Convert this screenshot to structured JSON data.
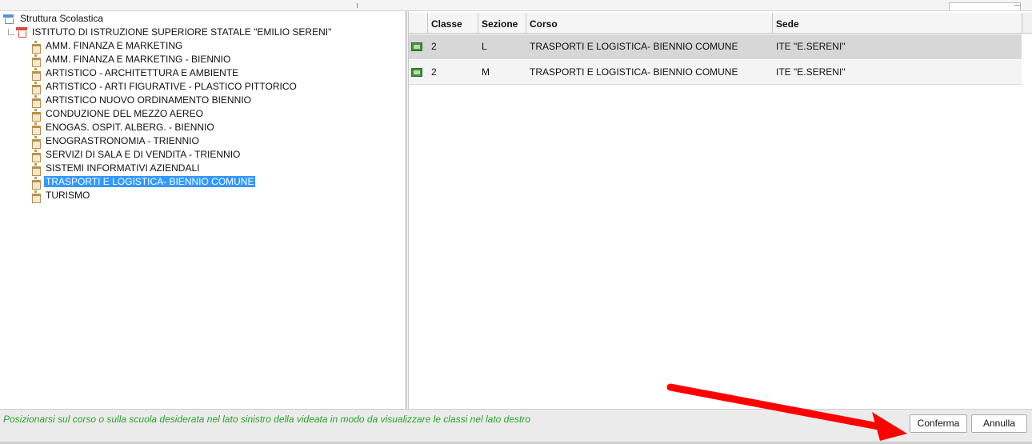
{
  "tree": {
    "root_label": "Struttura Scolastica",
    "school_label": "ISTITUTO DI ISTRUZIONE SUPERIORE STATALE \"EMILIO SERENI\"",
    "courses": [
      "AMM. FINANZA E MARKETING",
      "AMM. FINANZA E MARKETING - BIENNIO",
      "ARTISTICO - ARCHITETTURA E AMBIENTE",
      "ARTISTICO - ARTI FIGURATIVE - PLASTICO PITTORICO",
      "ARTISTICO NUOVO ORDINAMENTO BIENNIO",
      "CONDUZIONE DEL MEZZO AEREO",
      "ENOGAS. OSPIT. ALBERG. - BIENNIO",
      "ENOGRASTRONOMIA - TRIENNIO",
      "SERVIZI DI SALA E DI VENDITA - TRIENNIO",
      "SISTEMI INFORMATIVI AZIENDALI",
      "TRASPORTI E LOGISTICA- BIENNIO COMUNE",
      "TURISMO"
    ],
    "selected_index": 10
  },
  "table": {
    "columns": [
      "Classe",
      "Sezione",
      "Corso",
      "Sede"
    ],
    "rows": [
      [
        "2",
        "L",
        "TRASPORTI E LOGISTICA- BIENNIO COMUNE",
        "ITE \"E.SERENI\""
      ],
      [
        "2",
        "M",
        "TRASPORTI E LOGISTICA- BIENNIO COMUNE",
        "ITE \"E.SERENI\""
      ]
    ]
  },
  "status": {
    "message": "Posizionarsi sul corso o sulla scuola desiderata nel lato sinistro della videata in modo da visualizzare le classi nel lato destro"
  },
  "buttons": {
    "confirm": "Conferma",
    "cancel": "Annulla"
  },
  "colors": {
    "selection": "#3399ff",
    "status_text": "#2ca52c",
    "annotation_arrow": "#ff0000"
  },
  "icons": {
    "root": "school-structure-icon",
    "school": "school-building-icon",
    "course": "course-icon",
    "row": "class-icon"
  }
}
